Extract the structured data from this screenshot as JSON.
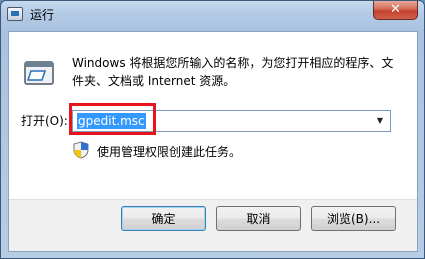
{
  "window": {
    "title": "运行",
    "close_glyph": "✕"
  },
  "dialog": {
    "description": "Windows 将根据您所输入的名称，为您打开相应的程序、文件夹、文档或 Internet 资源。",
    "open_label": "打开(O):",
    "command_value": "gpedit.msc",
    "admin_note": "使用管理权限创建此任务。"
  },
  "buttons": {
    "ok": "确定",
    "cancel": "取消",
    "browse": "浏览(B)..."
  },
  "icons": {
    "app": "run-program-icon",
    "shield": "uac-shield-icon",
    "dropdown": "chevron-down-icon",
    "close": "close-icon"
  },
  "colors": {
    "highlight": "#e8141b",
    "selection": "#3399ff",
    "close_button": "#c4412e"
  }
}
